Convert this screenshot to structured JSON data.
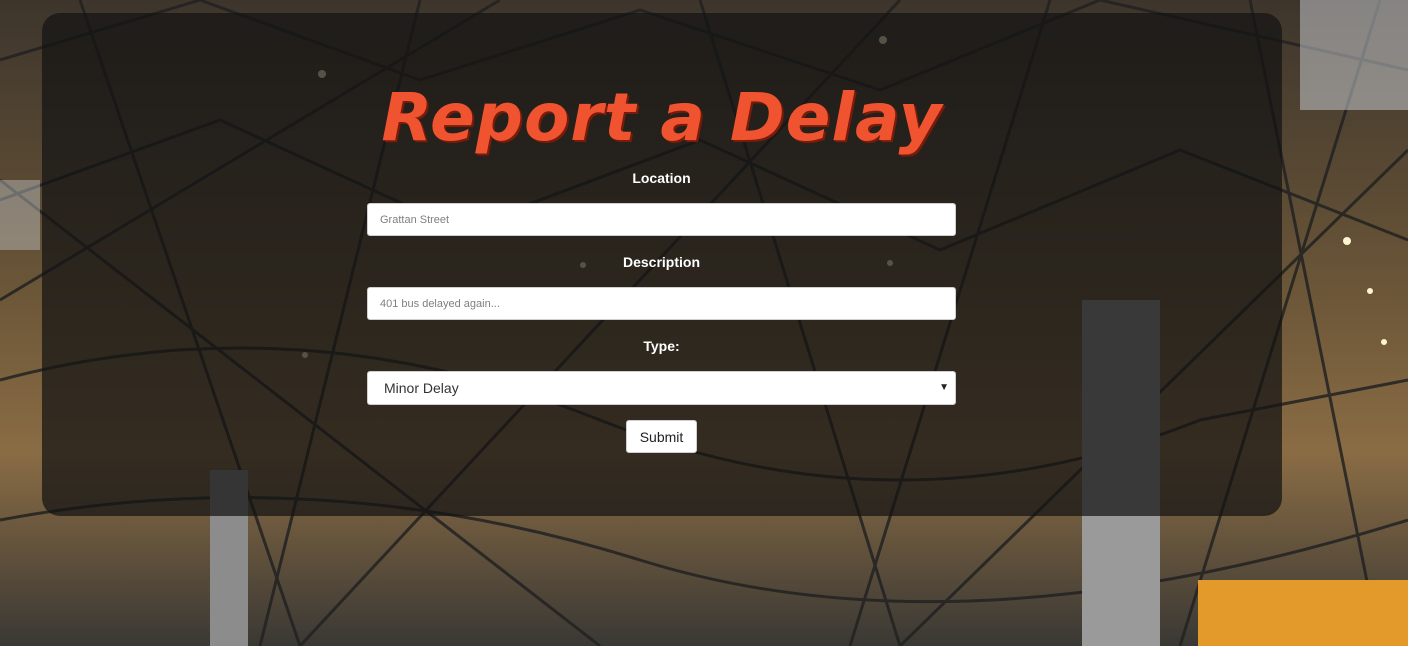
{
  "page": {
    "title": "Report a Delay",
    "title_color": "#f0532f"
  },
  "form": {
    "location": {
      "label": "Location",
      "placeholder": "Grattan Street",
      "value": ""
    },
    "description": {
      "label": "Description",
      "placeholder": "401 bus delayed again...",
      "value": ""
    },
    "type": {
      "label": "Type:",
      "selected": "Minor Delay",
      "arrow_icon": "caret-down-icon"
    },
    "submit_label": "Submit"
  },
  "background": {
    "description_icon": "station-roof-photo"
  }
}
